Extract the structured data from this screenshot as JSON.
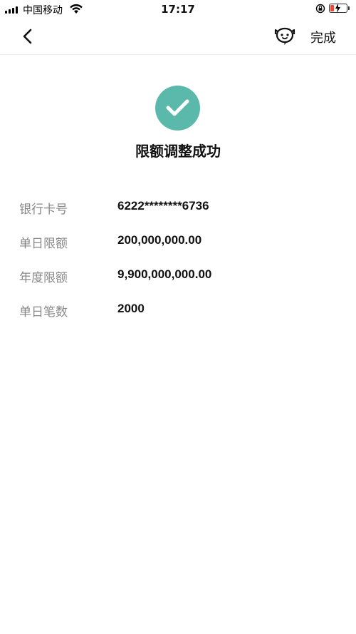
{
  "status_bar": {
    "carrier": "中国移动",
    "time": "17:17",
    "battery_color": "#e64a3a"
  },
  "nav": {
    "back_icon": "chevron-left-icon",
    "service_icon": "customer-service-icon",
    "done_label": "完成"
  },
  "result": {
    "icon": "check-circle-icon",
    "accent_color": "#5bb9ab",
    "title": "限额调整成功"
  },
  "details": [
    {
      "label": "银行卡号",
      "value": "6222********6736"
    },
    {
      "label": "单日限额",
      "value": "200,000,000.00"
    },
    {
      "label": "年度限额",
      "value": "9,900,000,000.00"
    },
    {
      "label": "单日笔数",
      "value": "2000"
    }
  ]
}
